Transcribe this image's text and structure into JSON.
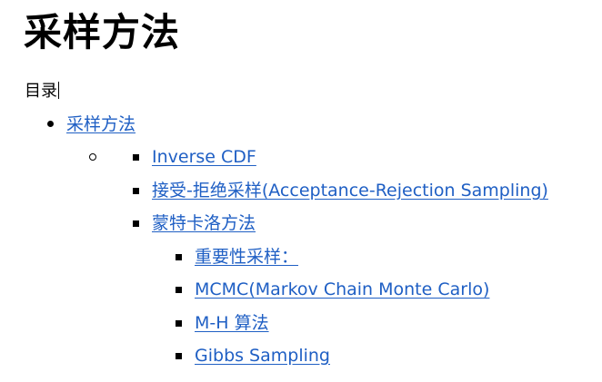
{
  "doc": {
    "title": "采样方法",
    "toc_label": "目录"
  },
  "toc": {
    "l1": {
      "label": "采样方法"
    },
    "l3": [
      {
        "label": "Inverse CDF"
      },
      {
        "label": "接受-拒绝采样(Acceptance-Rejection Sampling)"
      },
      {
        "label": "蒙特卡洛方法"
      }
    ],
    "l4": [
      {
        "label": "重要性采样："
      },
      {
        "label": "MCMC(Markov Chain Monte Carlo)"
      },
      {
        "label": "M-H 算法"
      },
      {
        "label": "Gibbs Sampling"
      }
    ]
  }
}
